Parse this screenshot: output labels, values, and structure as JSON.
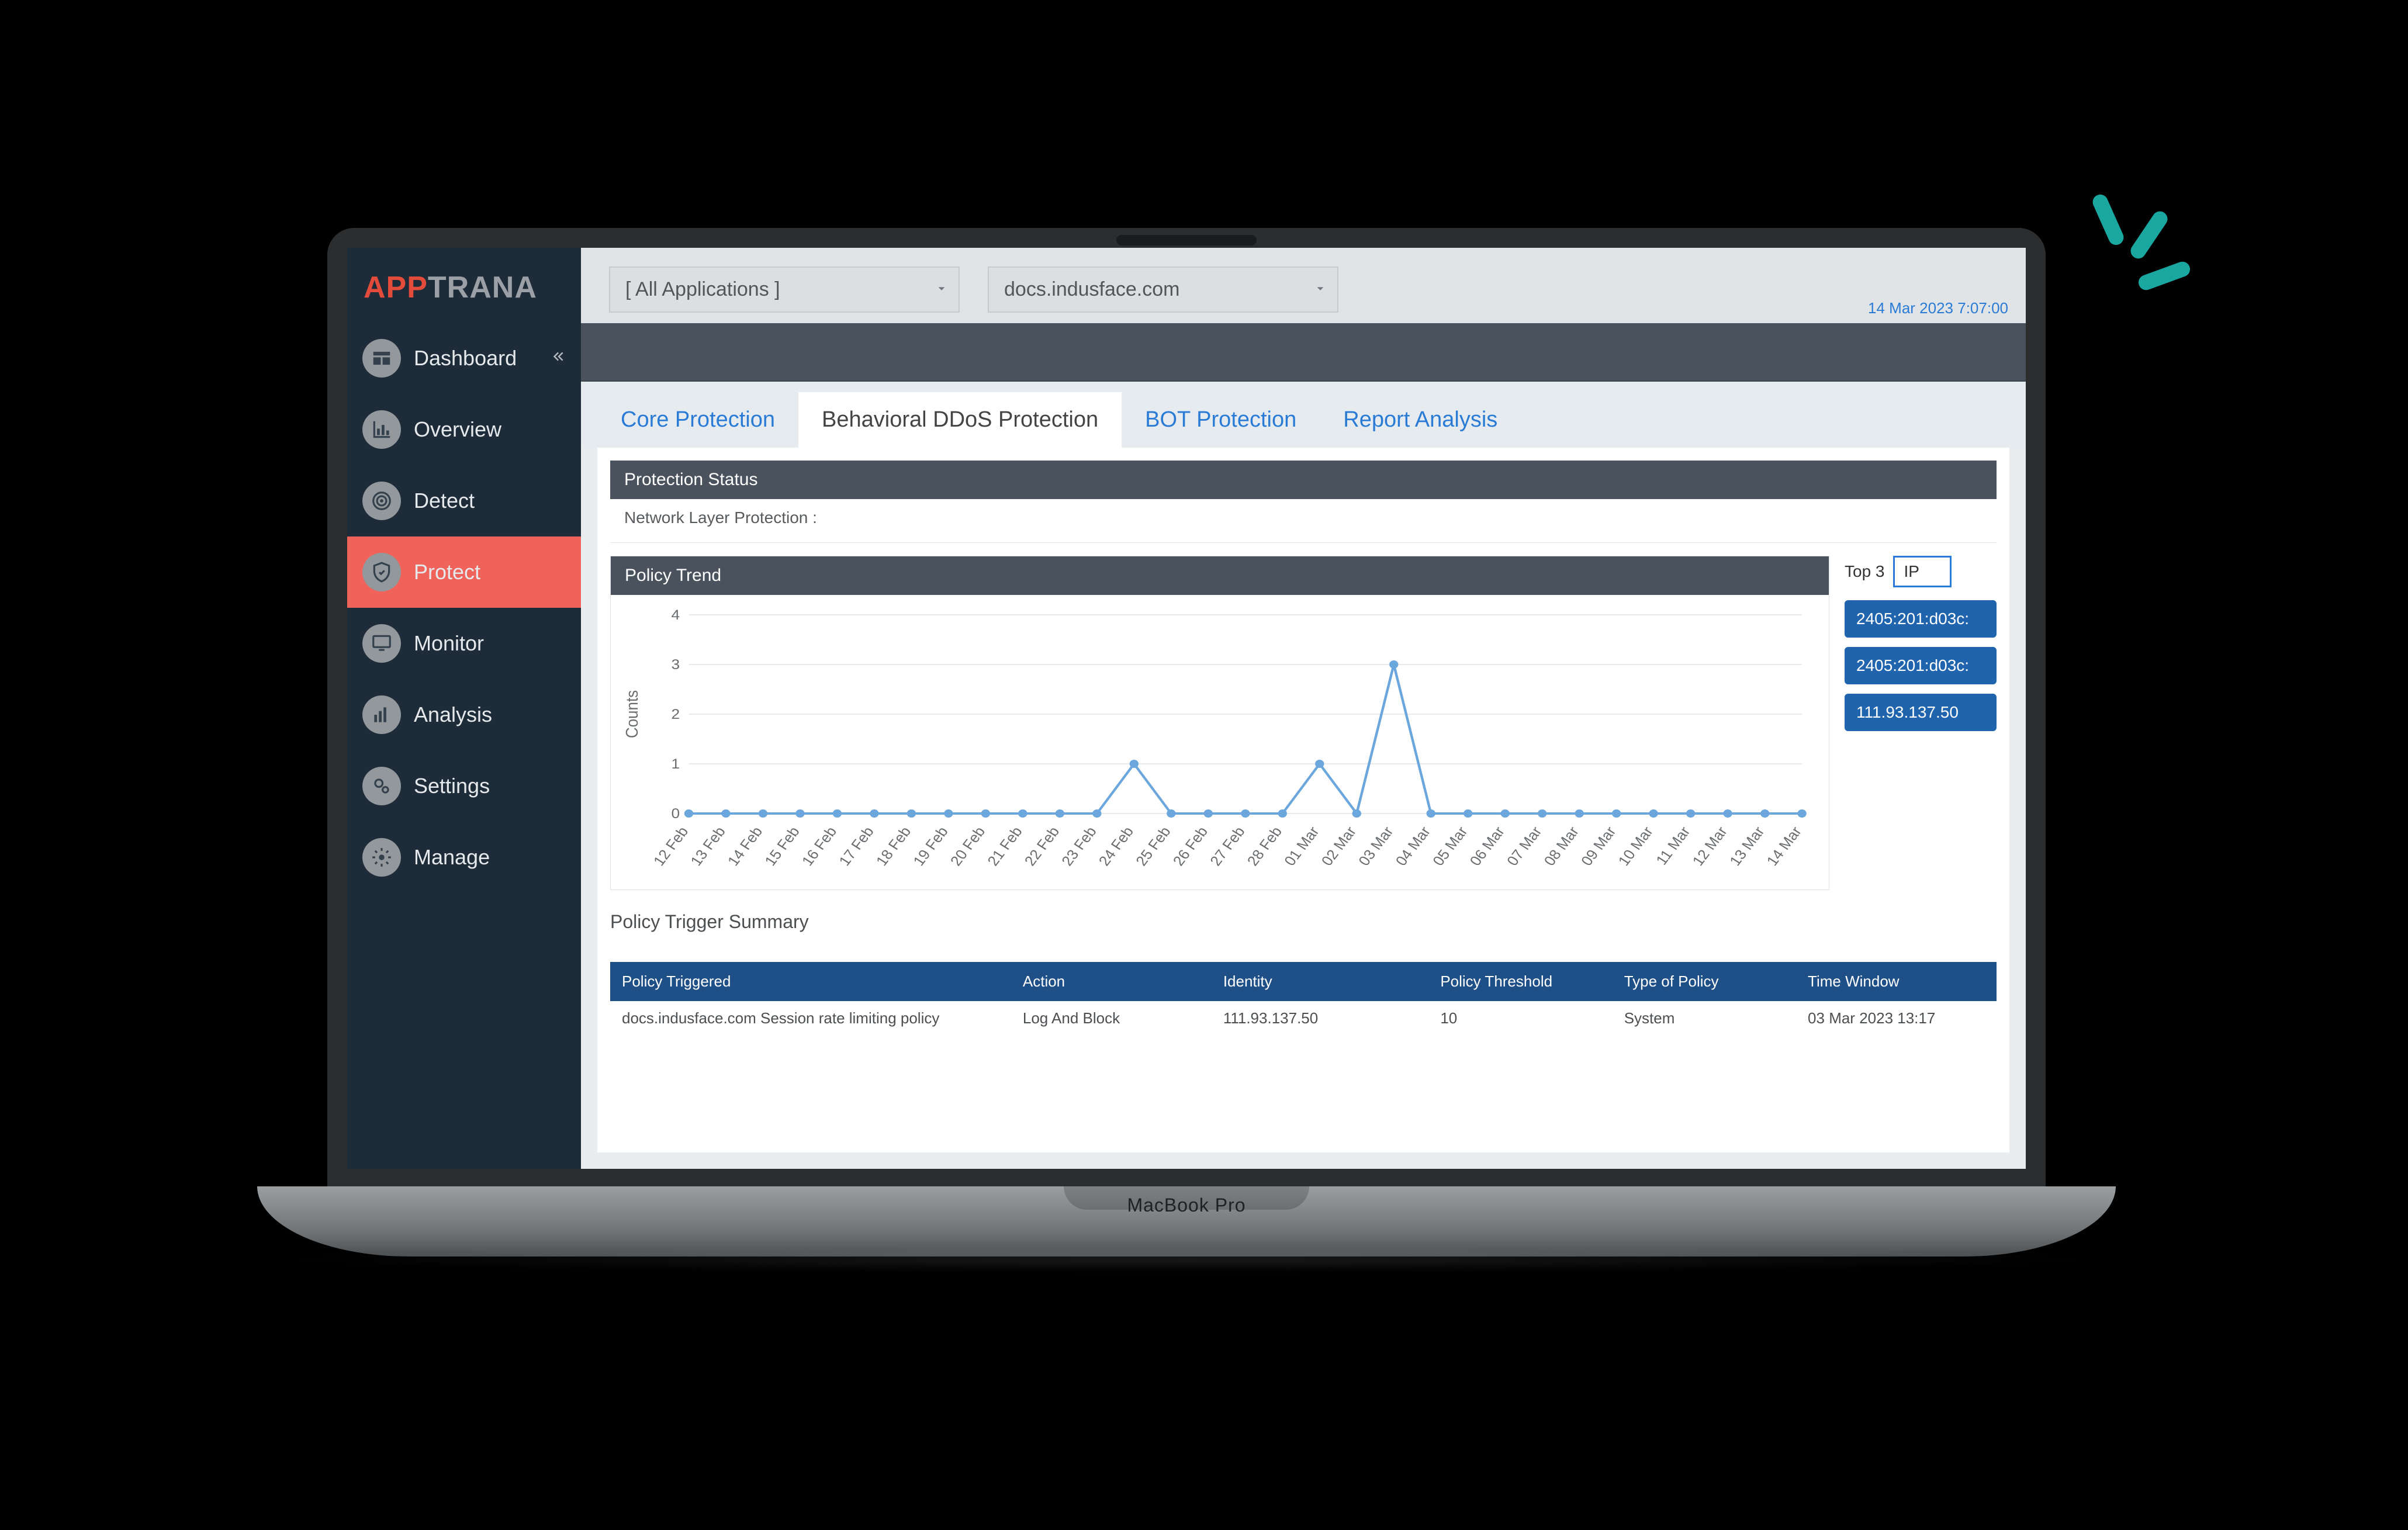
{
  "brand": {
    "part1": "APP",
    "part2": "TRANA"
  },
  "nav": {
    "items": [
      {
        "label": "Dashboard",
        "icon": "dashboard"
      },
      {
        "label": "Overview",
        "icon": "chart"
      },
      {
        "label": "Detect",
        "icon": "target"
      },
      {
        "label": "Protect",
        "icon": "shield"
      },
      {
        "label": "Monitor",
        "icon": "monitor"
      },
      {
        "label": "Analysis",
        "icon": "bars"
      },
      {
        "label": "Settings",
        "icon": "gears"
      },
      {
        "label": "Manage",
        "icon": "gear"
      }
    ],
    "active_index": 3
  },
  "topbar": {
    "group_select": "[ All Applications ]",
    "app_select": "docs.indusface.com",
    "timestamp": "14 Mar 2023 7:07:00"
  },
  "tabs": {
    "items": [
      "Core Protection",
      "Behavioral DDoS Protection",
      "BOT Protection",
      "Report Analysis"
    ],
    "active_index": 1
  },
  "panels": {
    "status_title": "Protection Status",
    "status_text": "Network Layer Protection :",
    "trend_title": "Policy Trend",
    "summary_title": "Policy Trigger Summary"
  },
  "top3": {
    "label": "Top 3",
    "select_value": "IP",
    "ips": [
      "2405:201:d03c:",
      "2405:201:d03c:",
      "111.93.137.50"
    ]
  },
  "table": {
    "headers": [
      "Policy Triggered",
      "Action",
      "Identity",
      "Policy Threshold",
      "Type of Policy",
      "Time Window"
    ],
    "rows": [
      [
        "docs.indusface.com Session rate limiting policy",
        "Log And Block",
        "111.93.137.50",
        "10",
        "System",
        "03 Mar 2023 13:17"
      ]
    ]
  },
  "chart_data": {
    "type": "line",
    "title": "Policy Trend",
    "xlabel": "",
    "ylabel": "Counts",
    "ylim": [
      0,
      4
    ],
    "categories": [
      "12 Feb",
      "13 Feb",
      "14 Feb",
      "15 Feb",
      "16 Feb",
      "17 Feb",
      "18 Feb",
      "19 Feb",
      "20 Feb",
      "21 Feb",
      "22 Feb",
      "23 Feb",
      "24 Feb",
      "25 Feb",
      "26 Feb",
      "27 Feb",
      "28 Feb",
      "01 Mar",
      "02 Mar",
      "03 Mar",
      "04 Mar",
      "05 Mar",
      "06 Mar",
      "07 Mar",
      "08 Mar",
      "09 Mar",
      "10 Mar",
      "11 Mar",
      "12 Mar",
      "13 Mar",
      "14 Mar"
    ],
    "values": [
      0,
      0,
      0,
      0,
      0,
      0,
      0,
      0,
      0,
      0,
      0,
      0,
      1,
      0,
      0,
      0,
      0,
      1,
      0,
      3,
      0,
      0,
      0,
      0,
      0,
      0,
      0,
      0,
      0,
      0,
      0
    ]
  },
  "device_label": "MacBook Pro"
}
